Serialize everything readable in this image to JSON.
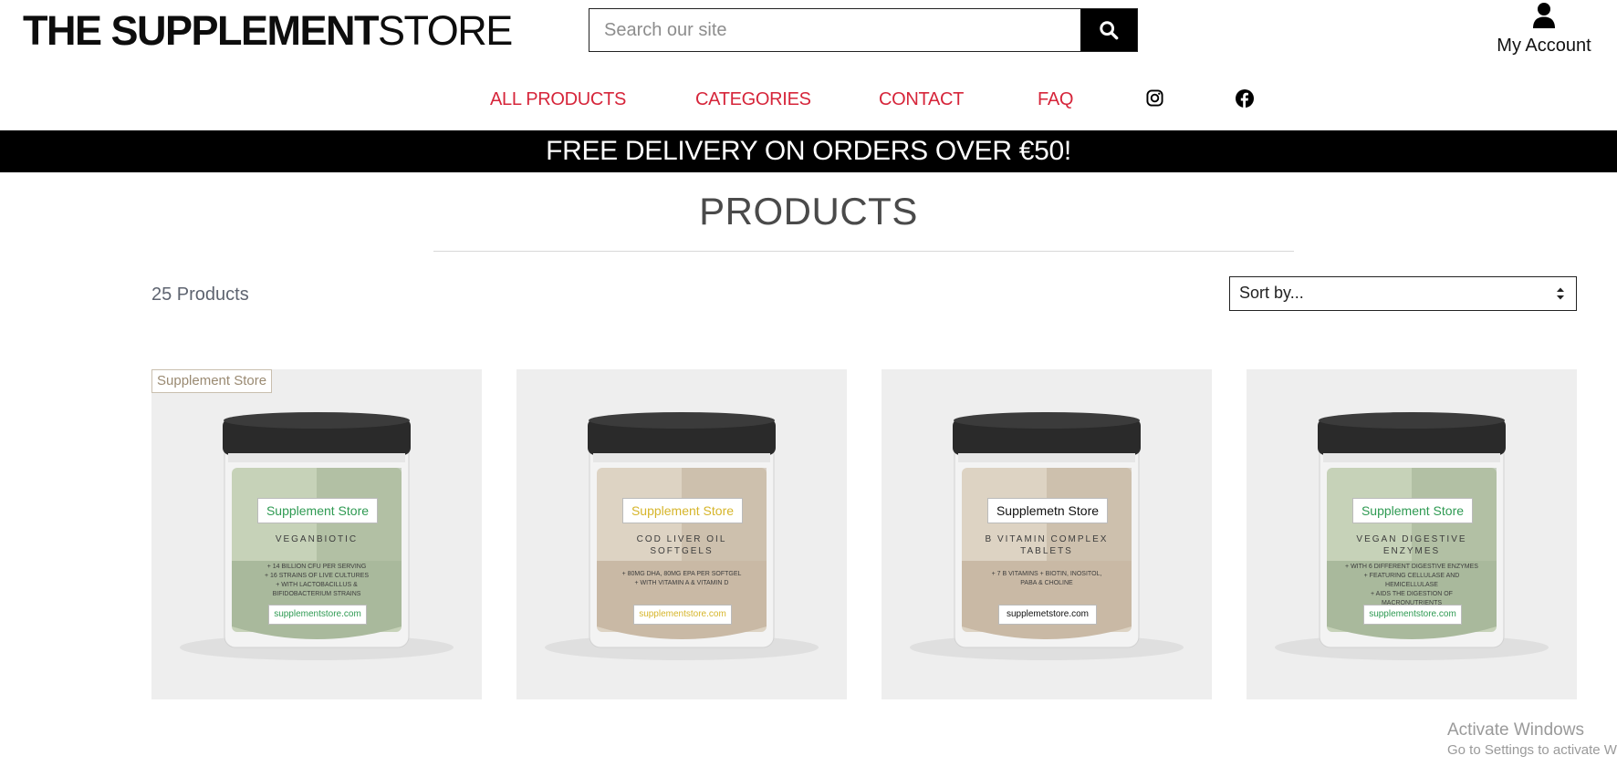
{
  "header": {
    "logo_bold": "THE SUPPLEMENT",
    "logo_light": "STORE",
    "search_placeholder": "Search our site",
    "account_label": "My Account"
  },
  "nav": {
    "all_products": "ALL PRODUCTS",
    "categories": "CATEGORIES",
    "contact": "CONTACT",
    "faq": "FAQ",
    "instagram_icon": "instagram-icon",
    "facebook_icon": "facebook-icon"
  },
  "banner": "FREE DELIVERY ON ORDERS OVER €50!",
  "page": {
    "title": "PRODUCTS",
    "count": "25 Products",
    "sort_label": "Sort by..."
  },
  "products": [
    {
      "tag": "Supplement Store",
      "label_brand": "Supplement Store",
      "brand_color": "#2e9a52",
      "label_title": "VEGANBIOTIC",
      "bullets": [
        "+ 14 BILLION CFU PER SERVING",
        "+ 16 STRAINS OF LIVE CULTURES",
        "+ WITH LACTOBACILLUS &",
        "BIFIDOBACTERIUM STRAINS"
      ],
      "url": "supplementstore.com",
      "palette": "green"
    },
    {
      "label_brand": "Supplement Store",
      "brand_color": "#d6b52a",
      "label_title": "COD LIVER OIL SOFTGELS",
      "bullets": [
        "+ 80MG DHA, 80MG EPA PER SOFTGEL",
        "+ WITH VITAMIN A & VITAMIN D"
      ],
      "url": "supplementstore.com",
      "palette": "beige"
    },
    {
      "label_brand": "Supplemetn Store",
      "brand_color": "#111111",
      "label_title": "B VITAMIN COMPLEX TABLETS",
      "bullets": [
        "+ 7 B VITAMINS + BIOTIN, INOSITOL,",
        "PABA & CHOLINE"
      ],
      "url": "supplemetstore.com",
      "palette": "beige"
    },
    {
      "label_brand": "Supplement Store",
      "brand_color": "#2e9a52",
      "label_title": "VEGAN DIGESTIVE ENZYMES",
      "bullets": [
        "+ WITH 6 DIFFERENT DIGESTIVE ENZYMES",
        "+ FEATURING CELLULASE AND",
        "HEMICELLULASE",
        "+ AIDS THE DIGESTION OF",
        "MACRONUTRIENTS"
      ],
      "url": "supplementstore.com",
      "palette": "green"
    }
  ],
  "watermark": {
    "line1": "Activate Windows",
    "line2": "Go to Settings to activate W"
  }
}
